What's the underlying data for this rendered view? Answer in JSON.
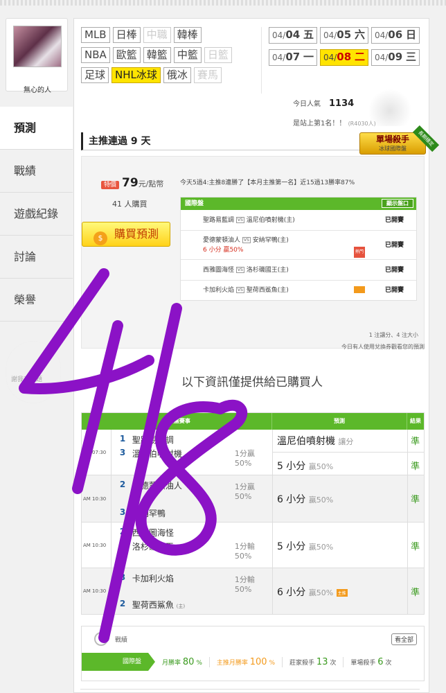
{
  "user": {
    "name": "無心的人"
  },
  "sidebar": {
    "items": [
      {
        "label": "預測"
      },
      {
        "label": "戰績"
      },
      {
        "label": "遊戲紀錄"
      },
      {
        "label": "討論"
      },
      {
        "label": "榮譽"
      }
    ],
    "bulb_text": "謝我有問題"
  },
  "sports": {
    "row1": [
      "MLB",
      "日棒",
      "中職",
      "韓棒"
    ],
    "row2": [
      "NBA",
      "歐籃",
      "韓籃",
      "中籃",
      "日籃"
    ],
    "row3": [
      "足球",
      "NHL冰球",
      "俄冰",
      "賽馬"
    ]
  },
  "dates": [
    {
      "m": "04/",
      "d": "04",
      "w": "五"
    },
    {
      "m": "04/",
      "d": "05",
      "w": "六"
    },
    {
      "m": "04/",
      "d": "06",
      "w": "日"
    },
    {
      "m": "04/",
      "d": "07",
      "w": "一"
    },
    {
      "m": "04/",
      "d": "08",
      "w": "二"
    },
    {
      "m": "04/",
      "d": "09",
      "w": "三"
    }
  ],
  "popularity": {
    "label": "今日人氣",
    "value": "1134"
  },
  "rank_note": {
    "text": "是站上第1名！！",
    "sub": "(R4030人)"
  },
  "streak_title": "主推連過 9 天",
  "badge": {
    "title": "單場殺手",
    "sub": "冰球國際盤",
    "ribbon": "長期穩定"
  },
  "price": {
    "badge": "特價",
    "value": "79",
    "unit": "元/點幣"
  },
  "buyers": {
    "count": "41",
    "label": "人購買"
  },
  "buy_button": "購買預測",
  "record": "今天5過4:主推8連勝了【本月主推第一名】近15過13勝率87%",
  "ptable": {
    "title": "國際盤",
    "toggle": "顯示盤口",
    "rows": [
      {
        "a": "聖路易藍調",
        "b": "溫尼伯噴射機(主)",
        "sub": "",
        "status": "已開賽"
      },
      {
        "a": "愛德蒙頓油人",
        "b": "安納罕鴨(主)",
        "sub": "6 小分 贏50%",
        "chip": "熱門",
        "status": "已開賽"
      },
      {
        "a": "西雅圖海怪",
        "b": "洛杉磯國王(主)",
        "sub": "",
        "status": "已開賽"
      },
      {
        "a": "卡加利火焰",
        "b": "聖荷西鯊魚(主)",
        "sub": "",
        "chip": "主推",
        "status": "已開賽"
      }
    ]
  },
  "pnote": "1 注讓分、4 注大小",
  "pnote2": "今日有人使用兌換券觀看您的預測",
  "locked_text": "以下資訊僅提供給已購買人",
  "gtable": {
    "headers": [
      "國際盤賽事",
      "預測",
      "結果"
    ],
    "rows": [
      {
        "time": "AM 07:30",
        "n1": "1",
        "t1": "聖路易藍調",
        "n2": "3",
        "t2": "溫尼伯噴射機",
        "hc": "1分贏",
        "hcp": "50%",
        "pred1": "溫尼伯噴射機",
        "pred1s": "讓分",
        "pred2": "5 小分",
        "pred2s": "贏50%",
        "res1": "準",
        "res2": "準"
      },
      {
        "time": "AM 10:30",
        "n1": "2",
        "t1": "愛德蒙頓油人",
        "n2": "3",
        "t2": "安納罕鴨",
        "hc": "1分贏",
        "hcp": "50%",
        "pred2": "6 小分",
        "pred2s": "贏50%",
        "res2": "準"
      },
      {
        "time": "AM 10:30",
        "n1": "2",
        "t1": "西雅圖海怪",
        "n2": "1",
        "t2": "洛杉磯國王",
        "h": "(主)",
        "hc": "1分輸",
        "hcp": "50%",
        "pred2": "5 小分",
        "pred2s": "贏50%",
        "res2": "準"
      },
      {
        "time": "AM 10:30",
        "n1": "3",
        "t1": "卡加利火焰",
        "n2": "2",
        "t2": "聖荷西鯊魚",
        "h": "(主)",
        "hc": "1分輸",
        "hcp": "50%",
        "pred2": "6 小分",
        "pred2s": "贏50%",
        "chip": "主推",
        "res2": "準"
      }
    ]
  },
  "stats": {
    "title": "戰績",
    "all": "看全部",
    "tab": "國際盤",
    "month_label": "月勝率",
    "month": "80",
    "main_label": "主推月勝率",
    "main": "100",
    "bank_label": "莊家殺手",
    "bank": "13",
    "single_label": "單場殺手",
    "single": "6",
    "pct": "%",
    "times": "次"
  },
  "handwriting": "4/8"
}
